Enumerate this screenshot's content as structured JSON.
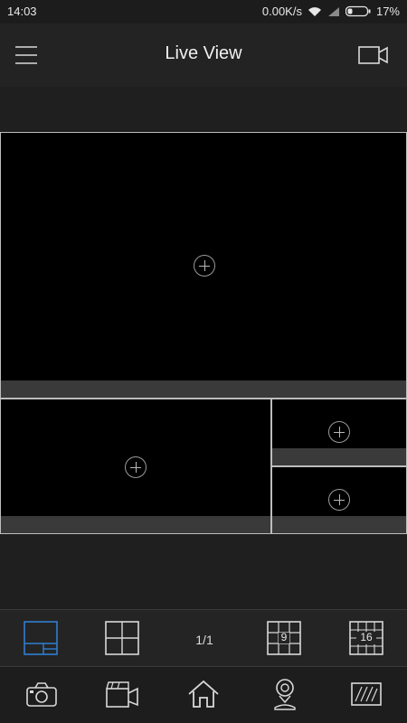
{
  "status_bar": {
    "time": "14:03",
    "network_speed": "0.00K/s",
    "battery": "17%"
  },
  "header": {
    "title": "Live View",
    "menu_icon": "hamburger-menu-icon",
    "record_icon": "video-camera-icon"
  },
  "grid": {
    "cells": [
      {
        "name": "channel-1"
      },
      {
        "name": "channel-2"
      },
      {
        "name": "channel-3"
      },
      {
        "name": "channel-4"
      }
    ]
  },
  "layout_bar": {
    "page_indicator": "1/1",
    "layouts": [
      {
        "icon": "layout-1plus3-icon",
        "selected": true
      },
      {
        "icon": "layout-4-icon",
        "selected": false
      },
      {
        "icon": "layout-9-icon",
        "label": "9",
        "selected": false
      },
      {
        "icon": "layout-16-icon",
        "label": "16",
        "selected": false
      }
    ]
  },
  "bottom_bar": {
    "items": [
      {
        "icon": "snapshot-camera-icon"
      },
      {
        "icon": "record-clip-icon"
      },
      {
        "icon": "home-icon"
      },
      {
        "icon": "ptz-control-icon"
      },
      {
        "icon": "fullscreen-icon"
      }
    ]
  },
  "colors": {
    "accent": "#2f7fd0",
    "background": "#1f1f1f",
    "cell_bar": "#3a3a3a"
  }
}
